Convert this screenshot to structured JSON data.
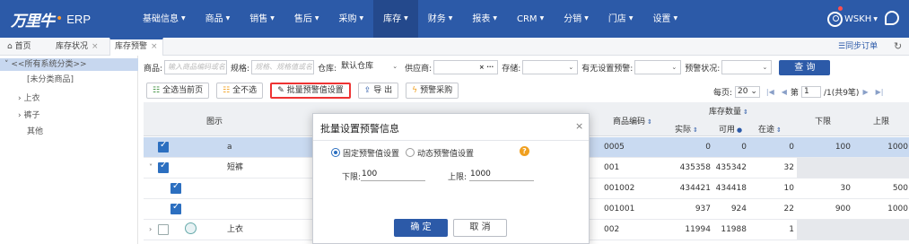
{
  "app": {
    "logo_mark": "万里牛",
    "logo_sub": "ERP"
  },
  "nav": {
    "menu": [
      {
        "label": "基础信息",
        "active": false
      },
      {
        "label": "商品",
        "active": false
      },
      {
        "label": "销售",
        "active": false
      },
      {
        "label": "售后",
        "active": false
      },
      {
        "label": "采购",
        "active": false
      },
      {
        "label": "库存",
        "active": true
      },
      {
        "label": "财务",
        "active": false
      },
      {
        "label": "报表",
        "active": false
      },
      {
        "label": "CRM",
        "active": false
      },
      {
        "label": "分销",
        "active": false
      },
      {
        "label": "门店",
        "active": false
      },
      {
        "label": "设置",
        "active": false
      }
    ],
    "user": "WSKH"
  },
  "tabs": {
    "home": "首页",
    "stock_status": "库存状况",
    "stock_alert": "库存预警",
    "sync_orders": "☰同步订单"
  },
  "sidebar": {
    "items": [
      "<<所有系统分类>>",
      "[未分类商品]",
      "上衣",
      "裤子",
      "其他"
    ]
  },
  "filters": {
    "product_label": "商品:",
    "product_placeholder": "输入商品编码或名",
    "spec_label": "规格:",
    "spec_placeholder": "规格、规格值或名",
    "warehouse_label": "仓库:",
    "warehouse_value": "默认仓库",
    "supplier_label": "供应商:",
    "area_label": "存储:",
    "has_alert_label": "有无设置预警:",
    "alert_status_label": "预警状况:",
    "query": "查 询"
  },
  "toolbar": {
    "select_page": "全选当前页",
    "deselect_all": "全不选",
    "batch_alert": "批量预警值设置",
    "export": "导 出",
    "alert_purchase": "预警采购"
  },
  "pager": {
    "per_page_label": "每页:",
    "per_page": "20",
    "page_prefix": "第",
    "page_value": "1",
    "page_suffix": "/1(共9笔)"
  },
  "grid": {
    "headers": {
      "image": "图示",
      "code": "商品编码",
      "stock_qty": "库存数量",
      "actual": "实际",
      "available": "可用",
      "in_transit": "在途",
      "lower": "下限",
      "upper": "上限"
    },
    "rows": [
      {
        "name": "a",
        "code": "0005",
        "actual": "0",
        "available": "0",
        "in_transit": "0",
        "lower": "100",
        "upper": "1000"
      },
      {
        "name": "短裤",
        "code": "001",
        "actual": "435358",
        "available": "435342",
        "in_transit": "32",
        "lower": "",
        "upper": ""
      },
      {
        "name": "",
        "code": "001002",
        "actual": "434421",
        "available": "434418",
        "in_transit": "10",
        "lower": "30",
        "upper": "500"
      },
      {
        "name": "",
        "code": "001001",
        "actual": "937",
        "available": "924",
        "in_transit": "22",
        "lower": "900",
        "upper": "1000"
      },
      {
        "name": "上衣",
        "code": "002",
        "actual": "11994",
        "available": "11988",
        "in_transit": "1",
        "lower": "",
        "upper": ""
      }
    ]
  },
  "modal": {
    "title": "批量设置预警信息",
    "fixed": "固定预警值设置",
    "dynamic": "动态预警值设置",
    "lower_label": "下限:",
    "lower_value": "100",
    "upper_label": "上限:",
    "upper_value": "1000",
    "ok": "确 定",
    "cancel": "取 消"
  }
}
